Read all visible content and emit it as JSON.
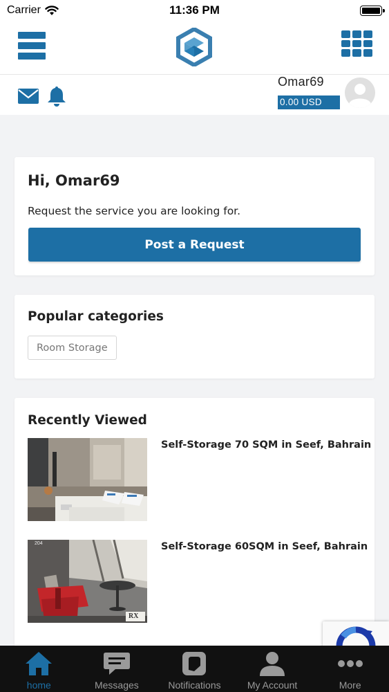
{
  "status_bar": {
    "carrier": "Carrier",
    "time": "11:36 PM"
  },
  "header": {
    "username": "Omar69",
    "balance": "0.00 USD"
  },
  "greeting": {
    "title": "Hi, Omar69",
    "subtitle": "Request the service you are looking for.",
    "button_label": "Post a Request"
  },
  "categories": {
    "title": "Popular categories",
    "items": [
      "Room Storage"
    ]
  },
  "recent": {
    "title": "Recently Viewed",
    "items": [
      {
        "title": "Self-Storage 70 SQM in Seef, Bahrain"
      },
      {
        "title": "Self-Storage 60SQM in Seef, Bahrain",
        "thumb_text": "204",
        "thumb_logo": "RX"
      }
    ]
  },
  "tabs": [
    {
      "label": "home",
      "icon": "home-icon",
      "active": true
    },
    {
      "label": "Messages",
      "icon": "chat-bubble-icon",
      "active": false
    },
    {
      "label": "Notifications",
      "icon": "notifications-icon",
      "active": false
    },
    {
      "label": "My Account",
      "icon": "person-icon",
      "active": false
    },
    {
      "label": "More",
      "icon": "more-dots-icon",
      "active": false
    }
  ],
  "colors": {
    "brand": "#1d6fa5",
    "background": "#f2f3f5",
    "tab_bar": "#111111",
    "tab_inactive": "#9a9a9a"
  }
}
